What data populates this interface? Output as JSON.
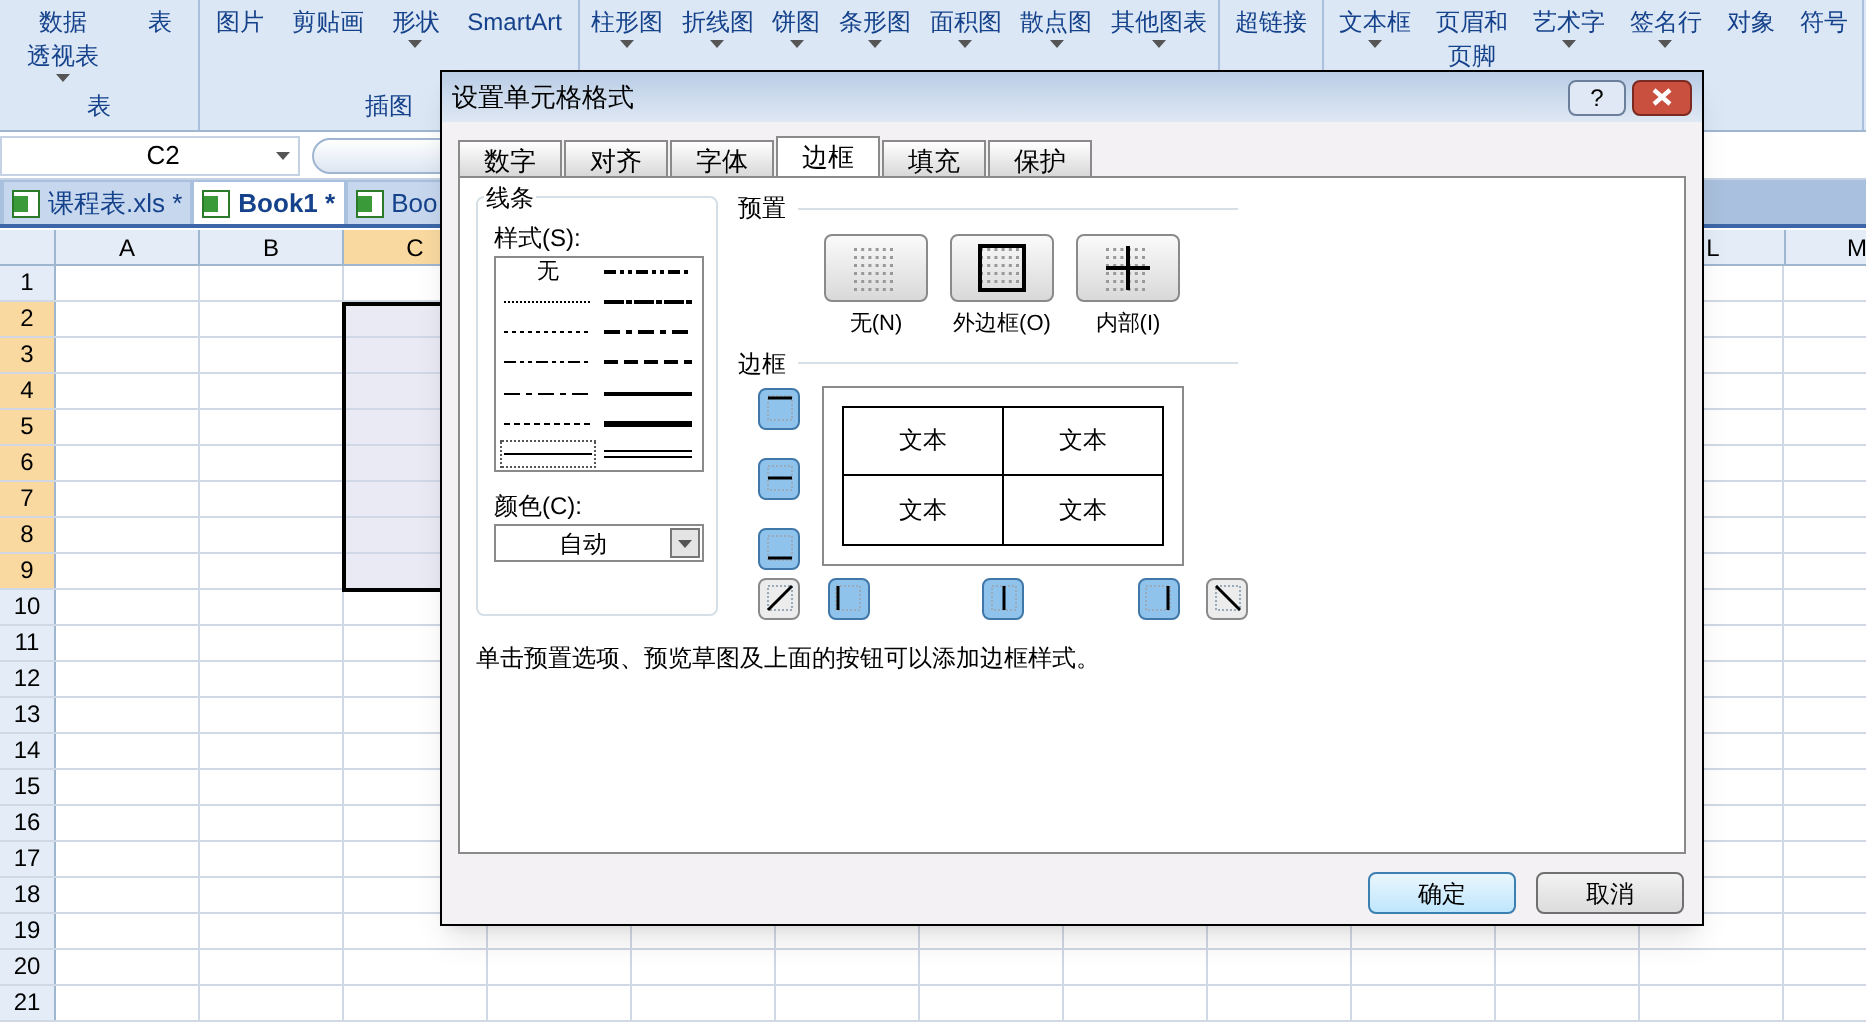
{
  "ribbon": {
    "groups": [
      {
        "label": "表",
        "items": [
          {
            "lines": [
              "数据",
              "透视表"
            ],
            "dropdown": true
          },
          {
            "lines": [
              "表"
            ],
            "dropdown": false
          }
        ]
      },
      {
        "label": "插图",
        "items": [
          {
            "lines": [
              "图片"
            ],
            "dropdown": false
          },
          {
            "lines": [
              "剪贴画"
            ],
            "dropdown": false
          },
          {
            "lines": [
              "形状"
            ],
            "dropdown": true
          },
          {
            "lines": [
              "SmartArt"
            ],
            "dropdown": false
          }
        ]
      },
      {
        "items": [
          {
            "lines": [
              "柱形图"
            ],
            "dropdown": true
          },
          {
            "lines": [
              "折线图"
            ],
            "dropdown": true
          },
          {
            "lines": [
              "饼图"
            ],
            "dropdown": true
          },
          {
            "lines": [
              "条形图"
            ],
            "dropdown": true
          },
          {
            "lines": [
              "面积图"
            ],
            "dropdown": true
          },
          {
            "lines": [
              "散点图"
            ],
            "dropdown": true
          },
          {
            "lines": [
              "其他图表"
            ],
            "dropdown": true
          }
        ]
      },
      {
        "items": [
          {
            "lines": [
              "超链接"
            ],
            "dropdown": false
          }
        ]
      },
      {
        "items": [
          {
            "lines": [
              "文本框"
            ],
            "dropdown": true
          },
          {
            "lines": [
              "页眉和",
              "页脚"
            ],
            "dropdown": false
          },
          {
            "lines": [
              "艺术字"
            ],
            "dropdown": true
          },
          {
            "lines": [
              "签名行"
            ],
            "dropdown": true
          },
          {
            "lines": [
              "对象"
            ],
            "dropdown": false
          },
          {
            "lines": [
              "符号"
            ],
            "dropdown": false
          }
        ]
      }
    ]
  },
  "name_box": {
    "value": "C2"
  },
  "sheet_tabs": [
    {
      "label": "课程表.xls *",
      "selected": false
    },
    {
      "label": "Book1 *",
      "selected": true
    },
    {
      "label": "Boo",
      "selected": false
    }
  ],
  "columns": [
    {
      "label": "A",
      "selected": false
    },
    {
      "label": "B",
      "selected": false
    },
    {
      "label": "C",
      "selected": true
    },
    {
      "label": "L",
      "selected": false
    },
    {
      "label": "M",
      "selected": false
    }
  ],
  "rows": [
    {
      "label": "1",
      "selected": false
    },
    {
      "label": "2",
      "selected": true
    },
    {
      "label": "3",
      "selected": true
    },
    {
      "label": "4",
      "selected": true
    },
    {
      "label": "5",
      "selected": true
    },
    {
      "label": "6",
      "selected": true
    },
    {
      "label": "7",
      "selected": true
    },
    {
      "label": "8",
      "selected": true
    },
    {
      "label": "9",
      "selected": true
    },
    {
      "label": "10",
      "selected": false
    },
    {
      "label": "11",
      "selected": false
    },
    {
      "label": "12",
      "selected": false
    },
    {
      "label": "13",
      "selected": false
    },
    {
      "label": "14",
      "selected": false
    },
    {
      "label": "15",
      "selected": false
    },
    {
      "label": "16",
      "selected": false
    },
    {
      "label": "17",
      "selected": false
    },
    {
      "label": "18",
      "selected": false
    },
    {
      "label": "19",
      "selected": false
    },
    {
      "label": "20",
      "selected": false
    },
    {
      "label": "21",
      "selected": false
    }
  ],
  "dialog": {
    "title": "设置单元格格式",
    "help": "?",
    "tabs": [
      {
        "label": "数字",
        "selected": false
      },
      {
        "label": "对齐",
        "selected": false
      },
      {
        "label": "字体",
        "selected": false
      },
      {
        "label": "边框",
        "selected": true
      },
      {
        "label": "填充",
        "selected": false
      },
      {
        "label": "保护",
        "selected": false
      }
    ],
    "line_group": {
      "title": "线条",
      "style_label": "样式(S):",
      "styles": [
        {
          "kind": "none",
          "label": "无",
          "selected": false
        },
        {
          "kind": "hair",
          "selected": false
        },
        {
          "kind": "dotted",
          "selected": false
        },
        {
          "kind": "dashdotdot",
          "selected": false
        },
        {
          "kind": "dashdot",
          "selected": false
        },
        {
          "kind": "dashed",
          "selected": false
        },
        {
          "kind": "thin",
          "selected": true
        },
        {
          "kind": "mediumdashdotdot",
          "selected": false
        },
        {
          "kind": "slantdashdot",
          "selected": false
        },
        {
          "kind": "mediumdashdot",
          "selected": false
        },
        {
          "kind": "mediumdashed",
          "selected": false
        },
        {
          "kind": "medium",
          "selected": false
        },
        {
          "kind": "thick",
          "selected": false
        },
        {
          "kind": "double",
          "selected": false
        }
      ],
      "color_label": "颜色(C):",
      "color_value": "自动"
    },
    "presets_title": "预置",
    "presets": [
      {
        "kind": "none",
        "label": "无(N)"
      },
      {
        "kind": "outline",
        "label": "外边框(O)"
      },
      {
        "kind": "inside",
        "label": "内部(I)"
      }
    ],
    "border_title": "边框",
    "border_buttons": [
      {
        "kind": "top",
        "selected": true
      },
      {
        "kind": "middle",
        "selected": true
      },
      {
        "kind": "bottom",
        "selected": true
      },
      {
        "kind": "diag_up",
        "selected": false
      },
      {
        "kind": "left",
        "selected": true
      },
      {
        "kind": "center",
        "selected": true
      },
      {
        "kind": "right",
        "selected": true
      },
      {
        "kind": "diag_down",
        "selected": false
      }
    ],
    "preview_cells": [
      "文本",
      "文本",
      "文本",
      "文本"
    ],
    "hint": "单击预置选项、预览草图及上面的按钮可以添加边框样式。",
    "buttons": [
      {
        "label": "确定",
        "default": true
      },
      {
        "label": "取消",
        "default": false
      }
    ]
  }
}
